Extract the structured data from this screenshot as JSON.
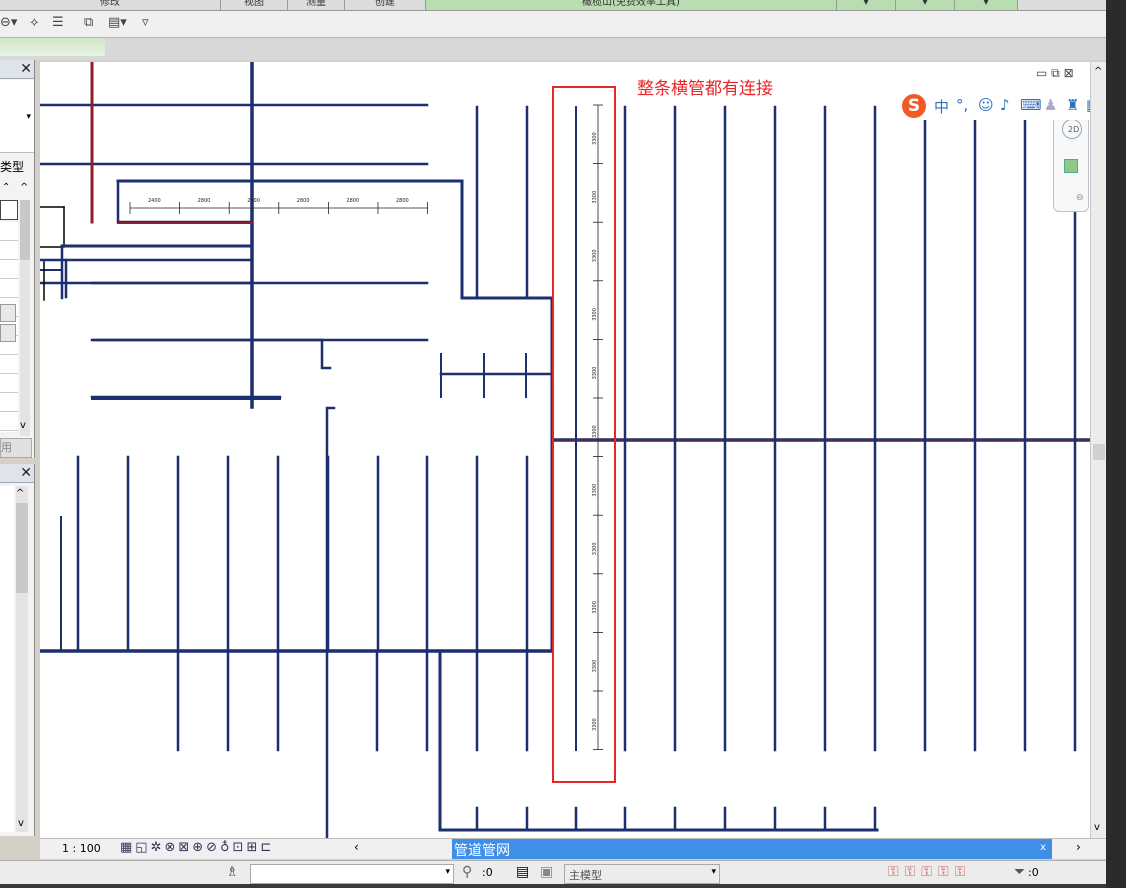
{
  "ribbon": {
    "tabs": [
      "修改",
      "视图",
      "测量",
      "创建",
      "橄榄山(免费效率工具)"
    ]
  },
  "quick_access": {
    "icons": [
      "undo-icon",
      "measure-icon",
      "thin-lines-icon",
      "close-hidden-icon",
      "switch-windows-icon",
      "customize-icon"
    ]
  },
  "properties_panel": {
    "close_label": "✕",
    "type_label": "类型",
    "apply_label": "用"
  },
  "browser_panel": {
    "close_label": "✕"
  },
  "annotation": {
    "text": "整条横管都有连接",
    "color": "#e8262a"
  },
  "dimensions": {
    "horizontal": [
      "2400",
      "2800",
      "2800",
      "2800",
      "2800",
      "2800"
    ],
    "vertical": [
      "3300",
      "3300",
      "3300",
      "3300",
      "3300",
      "3300",
      "3300",
      "3300",
      "3300",
      "3300",
      "3300"
    ]
  },
  "view_controls": {
    "scale": "1 : 100",
    "nav_2d": "2D"
  },
  "toast": {
    "title": "管道管网",
    "close": "x"
  },
  "status_bar": {
    "workset_value": ":0",
    "model_label": "主模型",
    "filter_count": ":0"
  },
  "colors": {
    "pipe": "#1c2f6e",
    "pipe_highlight": "#8b1f2b",
    "highlight_box": "#e8262a",
    "toast_bg": "#3f8fe8"
  }
}
